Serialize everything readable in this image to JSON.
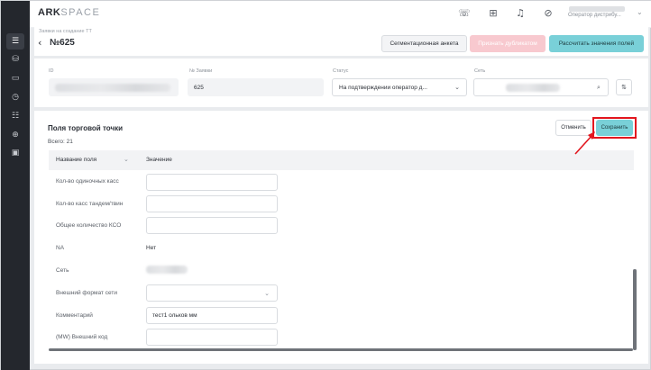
{
  "app": {
    "logo_bold": "ARK",
    "logo_light": "SPACE"
  },
  "sidebar": {
    "icons": [
      "panel-icon",
      "database-icon",
      "window-icon",
      "clock-icon",
      "filters-icon",
      "globe-icon",
      "calendar-icon"
    ]
  },
  "topbar": {
    "user_role": "Оператор дистрибу..."
  },
  "header": {
    "breadcrumb": "Заявки на создание ТТ",
    "title": "№625",
    "buttons": {
      "segment": "Сегментационная анкета",
      "duplicate": "Признать дубликатом",
      "calculate": "Рассчитать значения полей"
    }
  },
  "request": {
    "id_label": "ID",
    "number_label": "№ Заявки",
    "number_value": "625",
    "status_label": "Статус",
    "status_value": "На подтверждении оператор д...",
    "network_label": "Сеть"
  },
  "fields": {
    "title": "Поля торговой точки",
    "total": "Всего: 21",
    "cancel_label": "Отменить",
    "save_label": "Сохранить",
    "col_name": "Название поля",
    "col_value": "Значение",
    "rows": [
      {
        "label": "Кол-во одиночных касс",
        "value": ""
      },
      {
        "label": "Кол-во касс тандем/твин",
        "value": ""
      },
      {
        "label": "Общее количество КСО",
        "value": ""
      },
      {
        "label": "NA",
        "value": "Нет"
      },
      {
        "label": "Сеть",
        "value": ""
      },
      {
        "label": "Внешний формат сети",
        "value": ""
      },
      {
        "label": "Комментарий",
        "value": "тест1 ольков мм"
      },
      {
        "label": "(MW) Внешний код",
        "value": ""
      }
    ]
  },
  "colors": {
    "accent": "#79d0d8",
    "highlight": "#e2161e",
    "sidebar": "#24272d"
  }
}
